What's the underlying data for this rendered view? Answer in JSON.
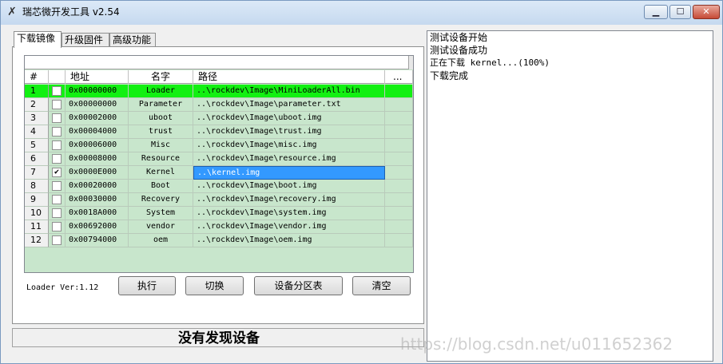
{
  "window": {
    "title": "瑞芯微开发工具 v2.54",
    "controls": {
      "min": "▁",
      "max": "☐",
      "close": "✕"
    }
  },
  "tabs": [
    "下载镜像",
    "升级固件",
    "高级功能"
  ],
  "table": {
    "headers": [
      "#",
      "",
      "地址",
      "名字",
      "路径",
      "..."
    ],
    "rows": [
      {
        "idx": "1",
        "checked": false,
        "addr": "0x00000000",
        "name": "Loader",
        "path": "..\\rockdev\\Image\\MiniLoaderAll.bin"
      },
      {
        "idx": "2",
        "checked": false,
        "addr": "0x00000000",
        "name": "Parameter",
        "path": "..\\rockdev\\Image\\parameter.txt"
      },
      {
        "idx": "3",
        "checked": false,
        "addr": "0x00002000",
        "name": "uboot",
        "path": "..\\rockdev\\Image\\uboot.img"
      },
      {
        "idx": "4",
        "checked": false,
        "addr": "0x00004000",
        "name": "trust",
        "path": "..\\rockdev\\Image\\trust.img"
      },
      {
        "idx": "5",
        "checked": false,
        "addr": "0x00006000",
        "name": "Misc",
        "path": "..\\rockdev\\Image\\misc.img"
      },
      {
        "idx": "6",
        "checked": false,
        "addr": "0x00008000",
        "name": "Resource",
        "path": "..\\rockdev\\Image\\resource.img"
      },
      {
        "idx": "7",
        "checked": true,
        "addr": "0x0000E000",
        "name": "Kernel",
        "path": "..\\kernel.img"
      },
      {
        "idx": "8",
        "checked": false,
        "addr": "0x00020000",
        "name": "Boot",
        "path": "..\\rockdev\\Image\\boot.img"
      },
      {
        "idx": "9",
        "checked": false,
        "addr": "0x00030000",
        "name": "Recovery",
        "path": "..\\rockdev\\Image\\recovery.img"
      },
      {
        "idx": "10",
        "checked": false,
        "addr": "0x0018A000",
        "name": "System",
        "path": "..\\rockdev\\Image\\system.img"
      },
      {
        "idx": "11",
        "checked": false,
        "addr": "0x00692000",
        "name": "vendor",
        "path": "..\\rockdev\\Image\\vendor.img"
      },
      {
        "idx": "12",
        "checked": false,
        "addr": "0x00794000",
        "name": "oem",
        "path": "..\\rockdev\\Image\\oem.img"
      }
    ],
    "selected_row_color": "#12f012",
    "grid_bg_color": "#c8e6cc"
  },
  "loader_version": "Loader Ver:1.12",
  "buttons": [
    "执行",
    "切换",
    "设备分区表",
    "清空"
  ],
  "status": "没有发现设备",
  "log": [
    "测试设备开始",
    "测试设备成功",
    "正在下载 kernel...(100%)",
    "下载完成"
  ],
  "watermark": "https://blog.csdn.net/u011652362"
}
